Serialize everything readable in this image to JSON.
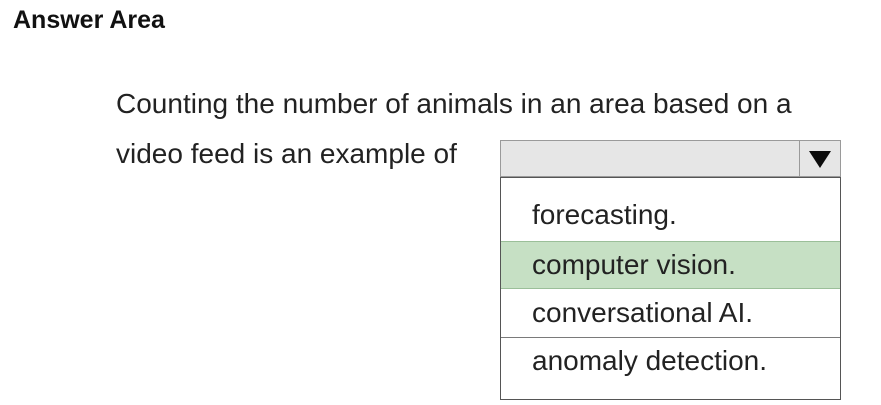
{
  "header": {
    "title": "Answer Area"
  },
  "question": {
    "line1": "Counting the number of animals in an area based on a",
    "line2": "video feed is an example of"
  },
  "dropdown": {
    "selected_value": "",
    "options": [
      {
        "label": "forecasting.",
        "highlighted": false
      },
      {
        "label": "computer vision.",
        "highlighted": true
      },
      {
        "label": "conversational AI.",
        "highlighted": false
      },
      {
        "label": "anomaly detection.",
        "highlighted": false
      }
    ],
    "arrow_icon": "triangle-down-icon",
    "highlight_color": "#c6e0c4"
  }
}
